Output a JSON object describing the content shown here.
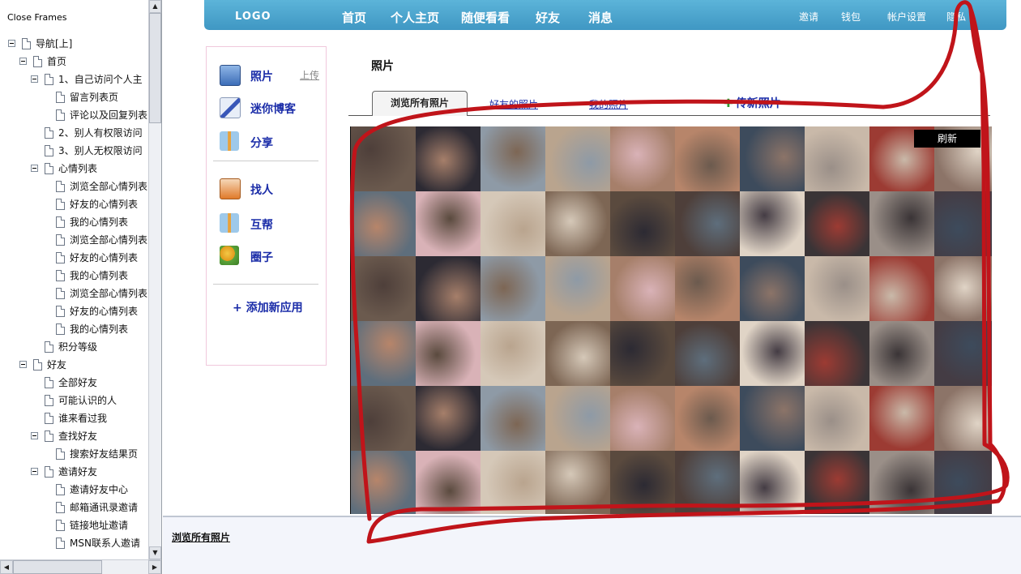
{
  "left_frame": {
    "close_frames": "Close Frames",
    "tree": [
      {
        "level": 0,
        "toggle": true,
        "label": "导航[上]"
      },
      {
        "level": 1,
        "toggle": true,
        "label": "首页"
      },
      {
        "level": 2,
        "toggle": true,
        "label": "1、自己访问个人主"
      },
      {
        "level": 3,
        "toggle": false,
        "label": "留言列表页"
      },
      {
        "level": 3,
        "toggle": false,
        "label": "评论以及回复列表"
      },
      {
        "level": 2,
        "toggle": false,
        "label": "2、别人有权限访问"
      },
      {
        "level": 2,
        "toggle": false,
        "label": "3、别人无权限访问"
      },
      {
        "level": 2,
        "toggle": true,
        "label": "心情列表"
      },
      {
        "level": 3,
        "toggle": false,
        "label": "浏览全部心情列表"
      },
      {
        "level": 3,
        "toggle": false,
        "label": "好友的心情列表"
      },
      {
        "level": 3,
        "toggle": false,
        "label": "我的心情列表"
      },
      {
        "level": 3,
        "toggle": false,
        "label": "浏览全部心情列表"
      },
      {
        "level": 3,
        "toggle": false,
        "label": "好友的心情列表"
      },
      {
        "level": 3,
        "toggle": false,
        "label": "我的心情列表"
      },
      {
        "level": 3,
        "toggle": false,
        "label": "浏览全部心情列表"
      },
      {
        "level": 3,
        "toggle": false,
        "label": "好友的心情列表"
      },
      {
        "level": 3,
        "toggle": false,
        "label": "我的心情列表"
      },
      {
        "level": 2,
        "toggle": false,
        "label": "积分等级"
      },
      {
        "level": 1,
        "toggle": true,
        "label": "好友"
      },
      {
        "level": 2,
        "toggle": false,
        "label": "全部好友"
      },
      {
        "level": 2,
        "toggle": false,
        "label": "可能认识的人"
      },
      {
        "level": 2,
        "toggle": false,
        "label": "谁来看过我"
      },
      {
        "level": 2,
        "toggle": true,
        "label": "查找好友"
      },
      {
        "level": 3,
        "toggle": false,
        "label": "搜索好友结果页"
      },
      {
        "level": 2,
        "toggle": true,
        "label": "邀请好友"
      },
      {
        "level": 3,
        "toggle": false,
        "label": "邀请好友中心"
      },
      {
        "level": 3,
        "toggle": false,
        "label": "邮箱通讯录邀请"
      },
      {
        "level": 3,
        "toggle": false,
        "label": "链接地址邀请"
      },
      {
        "level": 3,
        "toggle": false,
        "label": "MSN联系人邀请"
      }
    ]
  },
  "topnav": {
    "logo": "LOGO",
    "main": [
      "首页",
      "个人主页",
      "随便看看",
      "好友",
      "消息"
    ],
    "right": [
      "邀请",
      "钱包",
      "帐户设置",
      "隐私"
    ]
  },
  "apps": {
    "upload_link": "上传",
    "items": [
      {
        "label": "照片",
        "icon": "photo-icon"
      },
      {
        "label": "迷你博客",
        "icon": "pen-icon"
      },
      {
        "label": "分享",
        "icon": "gift-icon"
      },
      {
        "label": "找人",
        "icon": "find-icon"
      },
      {
        "label": "互帮",
        "icon": "gift-icon"
      },
      {
        "label": "圈子",
        "icon": "circle-icon"
      }
    ],
    "add_app": "+  添加新应用"
  },
  "photos": {
    "title": "照片",
    "tabs": [
      "浏览所有照片",
      "好友的照片",
      "我的照片"
    ],
    "upload_new": "传新照片",
    "refresh": "刷新"
  },
  "status_bar": {
    "link": "浏览所有照片"
  },
  "colors": {
    "nav_bg": "#4aa6cf",
    "link": "#1a2ca8",
    "annotation": "#c0141a"
  }
}
